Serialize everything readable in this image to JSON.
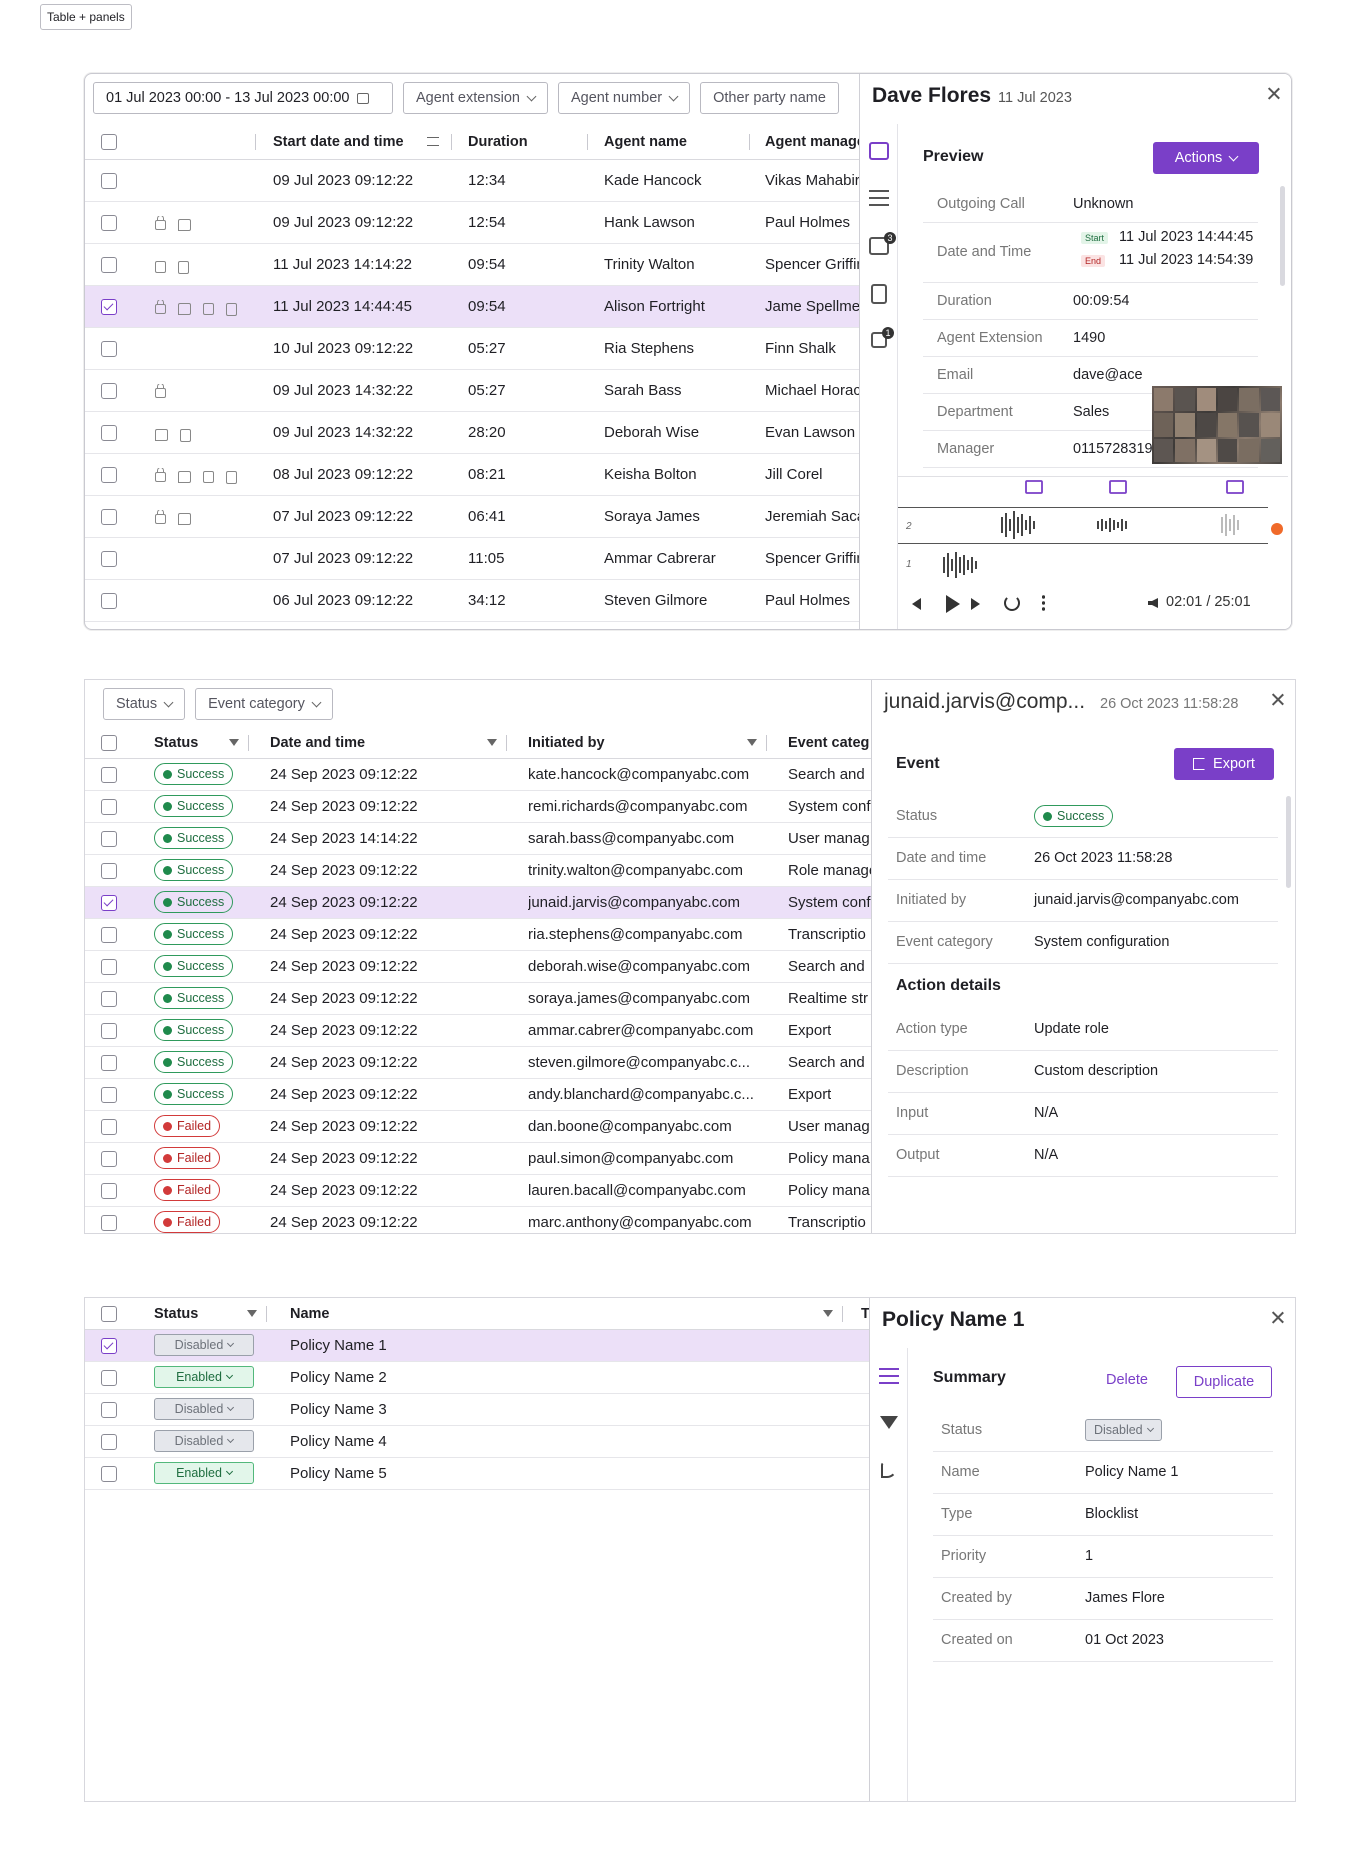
{
  "tag_label": "Table + panels",
  "s1": {
    "filters": {
      "date": "01 Jul 2023 00:00 - 13 Jul 2023 00:00",
      "agent_ext": "Agent extension",
      "agent_num": "Agent number",
      "other": "Other party name"
    },
    "headers": {
      "start": "Start date and time",
      "duration": "Duration",
      "agent": "Agent name",
      "manager": "Agent manager"
    },
    "rows": [
      {
        "date": "09 Jul 2023 09:12:22",
        "dur": "12:34",
        "agent": "Kade Hancock",
        "mgr": "Vikas Mahabir",
        "icons": []
      },
      {
        "date": "09 Jul 2023 09:12:22",
        "dur": "12:54",
        "agent": "Hank Lawson",
        "mgr": "Paul Holmes",
        "icons": [
          "lock",
          "chat"
        ]
      },
      {
        "date": "11 Jul 2023 14:14:22",
        "dur": "09:54",
        "agent": "Trinity Walton",
        "mgr": "Spencer Griffin",
        "icons": [
          "cam",
          "doc"
        ]
      },
      {
        "date": "11 Jul 2023 14:44:45",
        "dur": "09:54",
        "agent": "Alison Fortright",
        "mgr": "Jame Spellmen",
        "icons": [
          "lock",
          "chat",
          "cam",
          "doc"
        ],
        "sel": true
      },
      {
        "date": "10 Jul 2023 09:12:22",
        "dur": "05:27",
        "agent": "Ria Stephens",
        "mgr": "Finn Shalk",
        "icons": []
      },
      {
        "date": "09 Jul 2023 14:32:22",
        "dur": "05:27",
        "agent": "Sarah Bass",
        "mgr": "Michael Horace",
        "icons": [
          "lock"
        ]
      },
      {
        "date": "09 Jul 2023 14:32:22",
        "dur": "28:20",
        "agent": "Deborah Wise",
        "mgr": "Evan Lawson",
        "icons": [
          "chat",
          "doc"
        ]
      },
      {
        "date": "08 Jul 2023 09:12:22",
        "dur": "08:21",
        "agent": "Keisha Bolton",
        "mgr": "Jill Corel",
        "icons": [
          "lock",
          "chat",
          "cam",
          "doc"
        ]
      },
      {
        "date": "07 Jul 2023 09:12:22",
        "dur": "06:41",
        "agent": "Soraya James",
        "mgr": "Jeremiah Sacatini",
        "icons": [
          "lock",
          "chat"
        ]
      },
      {
        "date": "07 Jul 2023 09:12:22",
        "dur": "11:05",
        "agent": "Ammar Cabrerar",
        "mgr": "Spencer Griffin",
        "icons": []
      },
      {
        "date": "06 Jul 2023 09:12:22",
        "dur": "34:12",
        "agent": "Steven Gilmore",
        "mgr": "Paul Holmes",
        "icons": []
      }
    ],
    "panel": {
      "title": "Dave Flores",
      "date": "11 Jul 2023",
      "section": "Preview",
      "actions": "Actions",
      "rail_badges": {
        "chat": "3",
        "lock": "1"
      },
      "fields": [
        {
          "k": "Outgoing Call",
          "v": "Unknown"
        },
        {
          "k": "Date and Time",
          "start_tag": "Start",
          "start": "11 Jul 2023 14:44:45",
          "end_tag": "End",
          "end": "11 Jul 2023 14:54:39"
        },
        {
          "k": "Duration",
          "v": "00:09:54"
        },
        {
          "k": "Agent Extension",
          "v": "1490"
        },
        {
          "k": "Email",
          "v": "dave@ace"
        },
        {
          "k": "Department",
          "v": "Sales"
        },
        {
          "k": "Manager",
          "v": "0115728319"
        }
      ],
      "wave_labels": {
        "a": "2",
        "b": "1"
      },
      "time": "02:01 / 25:01"
    }
  },
  "s2": {
    "filters": {
      "status": "Status",
      "event": "Event category"
    },
    "headers": {
      "status": "Status",
      "date": "Date and time",
      "init": "Initiated by",
      "event": "Event categ"
    },
    "rows": [
      {
        "s": "Success",
        "d": "24 Sep 2023 09:12:22",
        "i": "kate.hancock@companyabc.com",
        "e": "Search and"
      },
      {
        "s": "Success",
        "d": "24 Sep 2023 09:12:22",
        "i": "remi.richards@companyabc.com",
        "e": "System conf"
      },
      {
        "s": "Success",
        "d": "24 Sep 2023 14:14:22",
        "i": "sarah.bass@companyabc.com",
        "e": "User manag"
      },
      {
        "s": "Success",
        "d": "24 Sep 2023 09:12:22",
        "i": "trinity.walton@companyabc.com",
        "e": "Role manage"
      },
      {
        "s": "Success",
        "d": "24 Sep 2023 09:12:22",
        "i": "junaid.jarvis@companyabc.com",
        "e": "System conf",
        "sel": true
      },
      {
        "s": "Success",
        "d": "24 Sep 2023 09:12:22",
        "i": "ria.stephens@companyabc.com",
        "e": "Transcriptio"
      },
      {
        "s": "Success",
        "d": "24 Sep 2023 09:12:22",
        "i": "deborah.wise@companyabc.com",
        "e": "Search and"
      },
      {
        "s": "Success",
        "d": "24 Sep 2023 09:12:22",
        "i": "soraya.james@companyabc.com",
        "e": "Realtime str"
      },
      {
        "s": "Success",
        "d": "24 Sep 2023 09:12:22",
        "i": "ammar.cabrer@companyabc.com",
        "e": "Export"
      },
      {
        "s": "Success",
        "d": "24 Sep 2023 09:12:22",
        "i": "steven.gilmore@companyabc.c...",
        "e": "Search and"
      },
      {
        "s": "Success",
        "d": "24 Sep 2023 09:12:22",
        "i": "andy.blanchard@companyabc.c...",
        "e": "Export"
      },
      {
        "s": "Failed",
        "d": "24 Sep 2023 09:12:22",
        "i": "dan.boone@companyabc.com",
        "e": "User manag"
      },
      {
        "s": "Failed",
        "d": "24 Sep 2023 09:12:22",
        "i": "paul.simon@companyabc.com",
        "e": "Policy mana"
      },
      {
        "s": "Failed",
        "d": "24 Sep 2023 09:12:22",
        "i": "lauren.bacall@companyabc.com",
        "e": "Policy mana"
      },
      {
        "s": "Failed",
        "d": "24 Sep 2023 09:12:22",
        "i": "marc.anthony@companyabc.com",
        "e": "Transcriptio"
      }
    ],
    "panel": {
      "title": "junaid.jarvis@comp...",
      "date": "26 Oct 2023 11:58:28",
      "section": "Event",
      "export": "Export",
      "fields": [
        {
          "k": "Status",
          "pill": "Success"
        },
        {
          "k": "Date and time",
          "v": "26 Oct 2023 11:58:28"
        },
        {
          "k": "Initiated by",
          "v": "junaid.jarvis@companyabc.com"
        },
        {
          "k": "Event category",
          "v": "System configuration"
        }
      ],
      "section2": "Action details",
      "fields2": [
        {
          "k": "Action type",
          "v": "Update role"
        },
        {
          "k": "Description",
          "v": "Custom description"
        },
        {
          "k": "Input",
          "v": "N/A"
        },
        {
          "k": "Output",
          "v": "N/A"
        }
      ]
    }
  },
  "s3": {
    "headers": {
      "status": "Status",
      "name": "Name",
      "t": "T"
    },
    "rows": [
      {
        "s": "Disabled",
        "n": "Policy Name 1",
        "sel": true
      },
      {
        "s": "Enabled",
        "n": "Policy Name 2"
      },
      {
        "s": "Disabled",
        "n": "Policy Name 3"
      },
      {
        "s": "Disabled",
        "n": "Policy Name 4"
      },
      {
        "s": "Enabled",
        "n": "Policy Name 5"
      }
    ],
    "panel": {
      "title": "Policy Name 1",
      "section": "Summary",
      "delete": "Delete",
      "duplicate": "Duplicate",
      "fields": [
        {
          "k": "Status",
          "badge": "Disabled"
        },
        {
          "k": "Name",
          "v": "Policy Name 1"
        },
        {
          "k": "Type",
          "v": "Blocklist"
        },
        {
          "k": "Priority",
          "v": "1"
        },
        {
          "k": "Created by",
          "v": "James Flore"
        },
        {
          "k": "Created on",
          "v": "01 Oct 2023"
        }
      ]
    }
  },
  "colors": {
    "accent": "#7a3fc8",
    "selected_row": "#ece0f8",
    "success": "#1f8a4c",
    "failed": "#d23a3a"
  }
}
